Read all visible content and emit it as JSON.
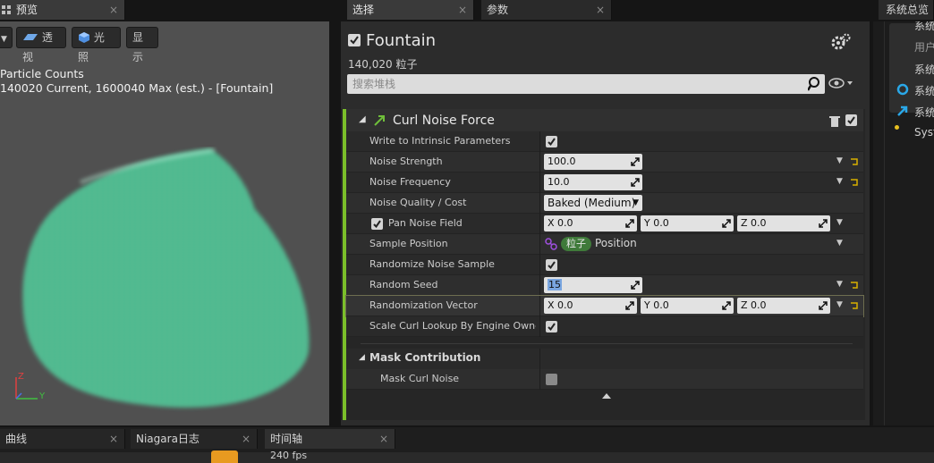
{
  "tabs": {
    "preview": "预览",
    "selection": "选择",
    "parameters": "参数",
    "system_overview": "系统总览",
    "close": "×"
  },
  "viewport": {
    "perspective_label": "透视",
    "lighting_label": "光照",
    "show_label": "显示",
    "overlay_title": "Particle Counts",
    "overlay_stats": "140020 Current, 1600040 Max (est.) - [Fountain]",
    "axis_z": "Z",
    "axis_y": "Y",
    "particle_color": "#5fd6a8"
  },
  "details": {
    "system_name": "Fountain",
    "particle_count": "140,020 粒子",
    "search_placeholder": "搜索堆栈"
  },
  "module": {
    "title": "Curl Noise Force",
    "rows": {
      "write_intrinsic": "Write to Intrinsic Parameters",
      "noise_strength": "Noise Strength",
      "noise_strength_value": "100.0",
      "noise_frequency": "Noise Frequency",
      "noise_frequency_value": "10.0",
      "noise_quality": "Noise Quality / Cost",
      "noise_quality_value": "Baked (Medium)",
      "pan_noise": "Pan Noise Field",
      "pan_x": "X 0.0",
      "pan_y": "Y 0.0",
      "pan_z": "Z 0.0",
      "sample_position": "Sample Position",
      "sample_pill": "粒子",
      "sample_value": "Position",
      "randomize_sample": "Randomize Noise Sample",
      "random_seed": "Random Seed",
      "random_seed_value": "15",
      "randomization_vector": "Randomization Vector",
      "rv_x": "X 0.0",
      "rv_y": "Y 0.0",
      "rv_z": "Z 0.0",
      "scale_curl": "Scale Curl Lookup By Engine Owner Scale"
    },
    "mask_section": "Mask Contribution",
    "mask_curl": "Mask Curl Noise"
  },
  "right_panel": {
    "item1": "系统",
    "item2": "用户",
    "item3": "系统",
    "item4": "系统",
    "item5": "系统",
    "item6": "Syst"
  },
  "bottom": {
    "curves": "曲线",
    "niagara_log": "Niagara日志",
    "timeline": "时间轴",
    "fps": "240 fps"
  },
  "colors": {
    "accent_green": "#7bbf2a",
    "reset_yellow": "#d8b000",
    "particle": "#5fd6a8"
  }
}
